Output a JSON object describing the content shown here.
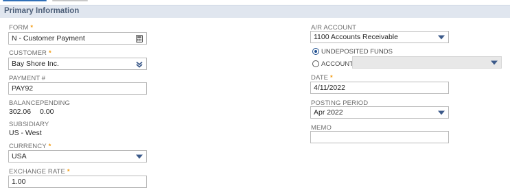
{
  "section_title": "Primary Information",
  "colors": {
    "required": "#f39c12",
    "header_bg": "#e0e6ef",
    "dropdown_arrow": "#3c5a8a"
  },
  "left": {
    "form": {
      "label": "FORM",
      "value": "N - Customer Payment",
      "icon": "calculator-icon"
    },
    "customer": {
      "label": "CUSTOMER",
      "value": "Bay Shore Inc.",
      "icon": "double-chevron-down-icon"
    },
    "payment_no": {
      "label": "PAYMENT #",
      "value": "PAY92"
    },
    "balance": {
      "label": "BALANCE",
      "value": "302.06"
    },
    "pending": {
      "label": "PENDING",
      "value": "0.00"
    },
    "subsidiary": {
      "label": "SUBSIDIARY",
      "value": "US - West"
    },
    "currency": {
      "label": "CURRENCY",
      "value": "USA",
      "icon": "dropdown-arrow-icon"
    },
    "exchange_rate": {
      "label": "EXCHANGE RATE",
      "value": "1.00"
    }
  },
  "right": {
    "ar_account": {
      "label": "A/R ACCOUNT",
      "value": "1100 Accounts Receivable",
      "icon": "dropdown-arrow-icon"
    },
    "undeposited": {
      "label": "UNDEPOSITED FUNDS",
      "selected": true
    },
    "account": {
      "label": "ACCOUNT",
      "value": "",
      "selected": false,
      "icon": "dropdown-arrow-icon"
    },
    "date": {
      "label": "DATE",
      "value": "4/11/2022"
    },
    "posting_period": {
      "label": "POSTING PERIOD",
      "value": "Apr 2022",
      "icon": "dropdown-arrow-icon"
    },
    "memo": {
      "label": "MEMO",
      "value": ""
    }
  },
  "required_marker": "*"
}
